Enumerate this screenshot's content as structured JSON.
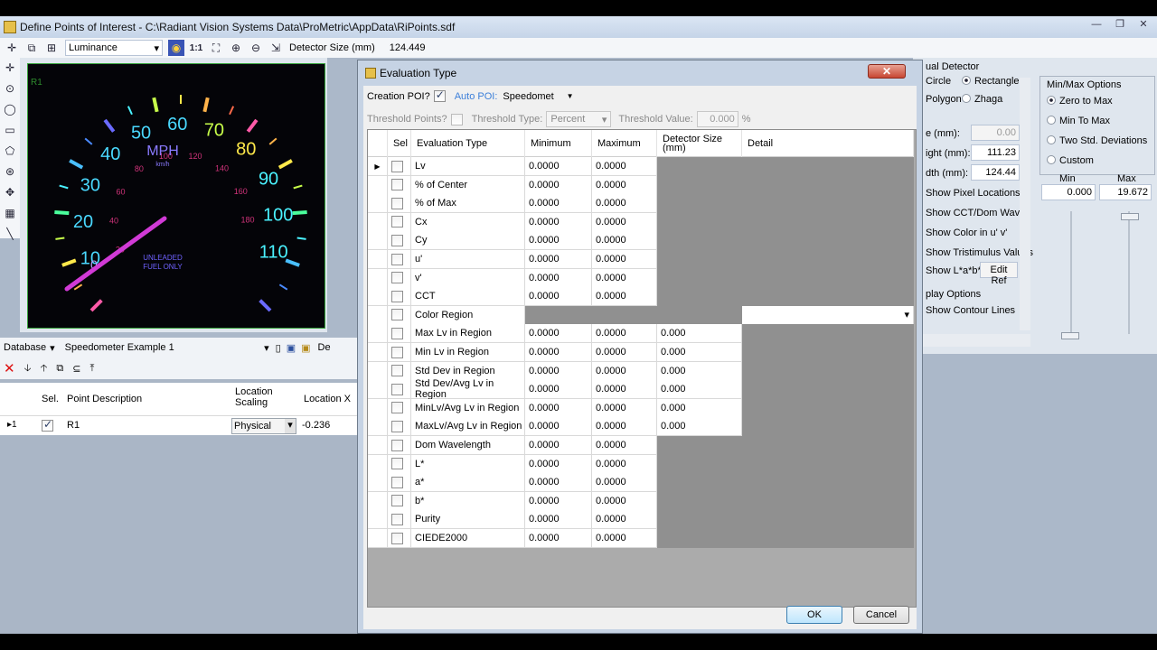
{
  "main_window": {
    "title": "Define Points of Interest - C:\\Radiant Vision Systems Data\\ProMetric\\AppData\\RiPoints.sdf",
    "toolbar": {
      "measurement_combo": "Luminance",
      "zoom_label": "1:1",
      "detector_size_label": "Detector Size (mm)",
      "detector_size_value": "124.449"
    },
    "image_overlay_label": "R1"
  },
  "speedometer": {
    "unit": "MPH",
    "unit_sub": "km/h",
    "badge_line1": "UNLEADED",
    "badge_line2": "FUEL ONLY",
    "mph_labels": [
      "10",
      "20",
      "30",
      "40",
      "50",
      "60",
      "70",
      "80",
      "90",
      "100",
      "110"
    ],
    "kmh_labels": [
      "20",
      "40",
      "60",
      "80",
      "100",
      "120",
      "140",
      "160",
      "180"
    ],
    "zero_label": "0"
  },
  "database": {
    "label": "Database",
    "selected": "Speedometer Example 1",
    "clip_label": "De"
  },
  "points_grid": {
    "headers": {
      "sel": "Sel.",
      "desc": "Point Description",
      "scaling": "Location Scaling",
      "locx": "Location X"
    },
    "rows": [
      {
        "marker": "▸1",
        "sel": true,
        "desc": "R1",
        "scaling": "Physical",
        "locx": "-0.236"
      }
    ]
  },
  "right_panel": {
    "detector_group": "ual Detector",
    "shape_circle": "Circle",
    "shape_rectangle": "Rectangle",
    "shape_polygon": "Polygon",
    "shape_zhaga": "Zhaga",
    "field_e_label": "e (mm):",
    "field_e_value": "0.00",
    "height_label": "ight (mm):",
    "height_value": "111.23",
    "width_label": "dth (mm):",
    "width_value": "124.44",
    "options": [
      "Show Pixel Locations",
      "Show CCT/Dom Wave",
      "Show Color in u' v'",
      "Show Tristimulus Values",
      "Show L*a*b*"
    ],
    "edit_ref": "Edit Ref",
    "display_options": "play Options",
    "show_contour": "Show Contour Lines",
    "minmax_title": "Min/Max Options",
    "minmax_options": [
      "Zero to Max",
      "Min To Max",
      "Two Std. Deviations",
      "Custom"
    ],
    "min_label": "Min",
    "max_label": "Max",
    "min_value": "0.000",
    "max_value": "19.672"
  },
  "dialog": {
    "title": "Evaluation Type",
    "close": "✕",
    "creation_poi_label": "Creation POI?",
    "auto_poi_label": "Auto POI:",
    "auto_poi_value": "Speedomet",
    "threshold_points_label": "Threshold Points?",
    "threshold_type_label": "Threshold Type:",
    "threshold_type_value": "Percent",
    "threshold_value_label": "Threshold Value:",
    "threshold_value": "0.000",
    "threshold_unit": "%",
    "grid_headers": {
      "sel": "Sel",
      "eval": "Evaluation Type",
      "min": "Minimum",
      "max": "Maximum",
      "det": "Detector Size (mm)",
      "detail": "Detail"
    },
    "rows": [
      {
        "name": "Lv",
        "min": "0.0000",
        "max": "0.0000",
        "det": "",
        "kind": "std"
      },
      {
        "name": "% of Center",
        "min": "0.0000",
        "max": "0.0000",
        "det": "",
        "kind": "std"
      },
      {
        "name": "% of Max",
        "min": "0.0000",
        "max": "0.0000",
        "det": "",
        "kind": "std"
      },
      {
        "name": "Cx",
        "min": "0.0000",
        "max": "0.0000",
        "det": "",
        "kind": "std"
      },
      {
        "name": "Cy",
        "min": "0.0000",
        "max": "0.0000",
        "det": "",
        "kind": "std"
      },
      {
        "name": "u'",
        "min": "0.0000",
        "max": "0.0000",
        "det": "",
        "kind": "std"
      },
      {
        "name": "v'",
        "min": "0.0000",
        "max": "0.0000",
        "det": "",
        "kind": "std"
      },
      {
        "name": "CCT",
        "min": "0.0000",
        "max": "0.0000",
        "det": "",
        "kind": "std"
      },
      {
        "name": "Color Region",
        "min": "",
        "max": "",
        "det": "",
        "kind": "region"
      },
      {
        "name": "Max Lv in Region",
        "min": "0.0000",
        "max": "0.0000",
        "det": "0.000",
        "kind": "det"
      },
      {
        "name": "Min Lv in Region",
        "min": "0.0000",
        "max": "0.0000",
        "det": "0.000",
        "kind": "det"
      },
      {
        "name": "Std Dev in Region",
        "min": "0.0000",
        "max": "0.0000",
        "det": "0.000",
        "kind": "det"
      },
      {
        "name": "Std Dev/Avg Lv in Region",
        "min": "0.0000",
        "max": "0.0000",
        "det": "0.000",
        "kind": "det"
      },
      {
        "name": "MinLv/Avg Lv in Region",
        "min": "0.0000",
        "max": "0.0000",
        "det": "0.000",
        "kind": "det"
      },
      {
        "name": "MaxLv/Avg Lv in Region",
        "min": "0.0000",
        "max": "0.0000",
        "det": "0.000",
        "kind": "det"
      },
      {
        "name": "Dom Wavelength",
        "min": "0.0000",
        "max": "0.0000",
        "det": "",
        "kind": "std"
      },
      {
        "name": "L*",
        "min": "0.0000",
        "max": "0.0000",
        "det": "",
        "kind": "std"
      },
      {
        "name": "a*",
        "min": "0.0000",
        "max": "0.0000",
        "det": "",
        "kind": "std"
      },
      {
        "name": "b*",
        "min": "0.0000",
        "max": "0.0000",
        "det": "",
        "kind": "std"
      },
      {
        "name": "Purity",
        "min": "0.0000",
        "max": "0.0000",
        "det": "",
        "kind": "std"
      },
      {
        "name": "CIEDE2000",
        "min": "0.0000",
        "max": "0.0000",
        "det": "",
        "kind": "std"
      }
    ],
    "ok_label": "OK",
    "cancel_label": "Cancel"
  }
}
